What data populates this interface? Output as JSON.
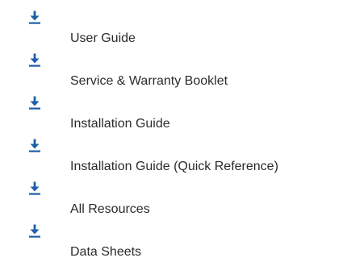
{
  "resources": {
    "icon": "download-icon",
    "icon_color": "#1f5fa8",
    "items": [
      {
        "label": "User Guide"
      },
      {
        "label": "Service & Warranty Booklet"
      },
      {
        "label": "Installation Guide"
      },
      {
        "label": "Installation Guide (Quick Reference)"
      },
      {
        "label": "All Resources"
      },
      {
        "label": "Data Sheets"
      }
    ]
  }
}
